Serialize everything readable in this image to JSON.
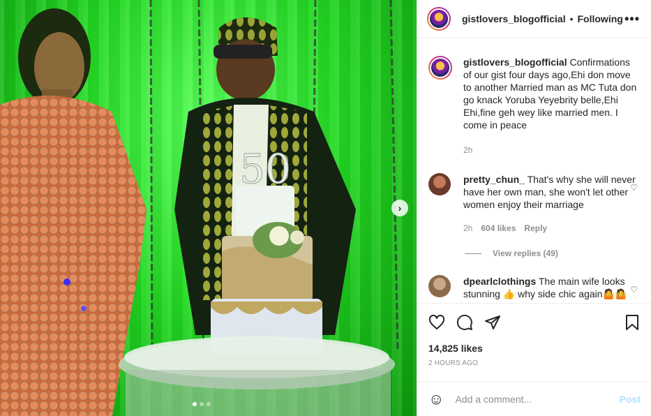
{
  "post": {
    "author": "gistlovers_blogofficial",
    "separator": "•",
    "follow_status": "Following",
    "more_label": "•••"
  },
  "caption": {
    "username": "gistlovers_blogofficial",
    "text": "Confirmations of our gist four days ago,Ehi don move to another Married man as MC Tuta don go knack Yoruba Yeyebrity belle,Ehi Ehi,fine geh wey like married men. I come in peace",
    "age": "2h"
  },
  "comments": [
    {
      "username": "pretty_chun_",
      "text": "That's why she will never have her own man, she won't let other women enjoy their marriage",
      "age": "2h",
      "likes": "604 likes",
      "reply_label": "Reply",
      "view_replies": "View replies (49)"
    },
    {
      "username": "dpearlclothings",
      "text": "The main wife looks stunning 👍 why side chic again🤷🤷"
    }
  ],
  "photo": {
    "cake_topper": "50",
    "next_arrow": "›"
  },
  "stats": {
    "likes": "14,825 likes",
    "posted": "2 HOURS AGO"
  },
  "composer": {
    "emoji": "☺",
    "placeholder": "Add a comment...",
    "post_label": "Post"
  },
  "colors": {
    "accent_disabled": "#b2dffc",
    "muted": "#8e8e8e",
    "photo_green": "#22d822"
  }
}
